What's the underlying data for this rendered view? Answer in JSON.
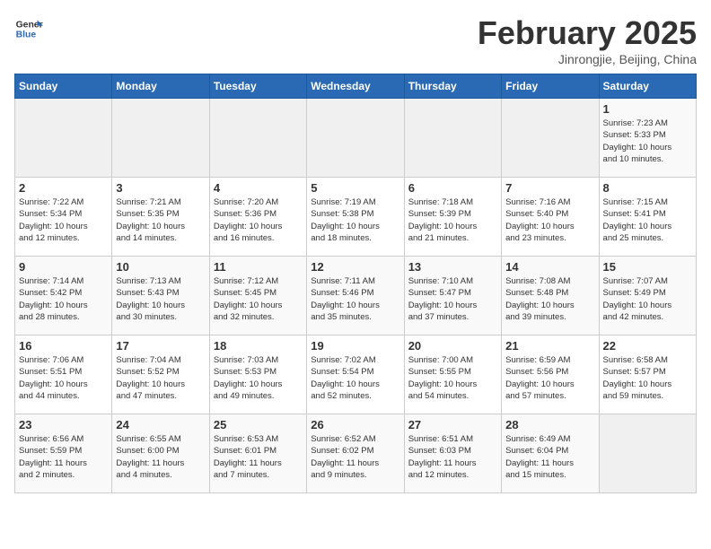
{
  "header": {
    "logo_general": "General",
    "logo_blue": "Blue",
    "month_title": "February 2025",
    "subtitle": "Jinrongjie, Beijing, China"
  },
  "days_of_week": [
    "Sunday",
    "Monday",
    "Tuesday",
    "Wednesday",
    "Thursday",
    "Friday",
    "Saturday"
  ],
  "weeks": [
    [
      {
        "day": "",
        "info": ""
      },
      {
        "day": "",
        "info": ""
      },
      {
        "day": "",
        "info": ""
      },
      {
        "day": "",
        "info": ""
      },
      {
        "day": "",
        "info": ""
      },
      {
        "day": "",
        "info": ""
      },
      {
        "day": "1",
        "info": "Sunrise: 7:23 AM\nSunset: 5:33 PM\nDaylight: 10 hours\nand 10 minutes."
      }
    ],
    [
      {
        "day": "2",
        "info": "Sunrise: 7:22 AM\nSunset: 5:34 PM\nDaylight: 10 hours\nand 12 minutes."
      },
      {
        "day": "3",
        "info": "Sunrise: 7:21 AM\nSunset: 5:35 PM\nDaylight: 10 hours\nand 14 minutes."
      },
      {
        "day": "4",
        "info": "Sunrise: 7:20 AM\nSunset: 5:36 PM\nDaylight: 10 hours\nand 16 minutes."
      },
      {
        "day": "5",
        "info": "Sunrise: 7:19 AM\nSunset: 5:38 PM\nDaylight: 10 hours\nand 18 minutes."
      },
      {
        "day": "6",
        "info": "Sunrise: 7:18 AM\nSunset: 5:39 PM\nDaylight: 10 hours\nand 21 minutes."
      },
      {
        "day": "7",
        "info": "Sunrise: 7:16 AM\nSunset: 5:40 PM\nDaylight: 10 hours\nand 23 minutes."
      },
      {
        "day": "8",
        "info": "Sunrise: 7:15 AM\nSunset: 5:41 PM\nDaylight: 10 hours\nand 25 minutes."
      }
    ],
    [
      {
        "day": "9",
        "info": "Sunrise: 7:14 AM\nSunset: 5:42 PM\nDaylight: 10 hours\nand 28 minutes."
      },
      {
        "day": "10",
        "info": "Sunrise: 7:13 AM\nSunset: 5:43 PM\nDaylight: 10 hours\nand 30 minutes."
      },
      {
        "day": "11",
        "info": "Sunrise: 7:12 AM\nSunset: 5:45 PM\nDaylight: 10 hours\nand 32 minutes."
      },
      {
        "day": "12",
        "info": "Sunrise: 7:11 AM\nSunset: 5:46 PM\nDaylight: 10 hours\nand 35 minutes."
      },
      {
        "day": "13",
        "info": "Sunrise: 7:10 AM\nSunset: 5:47 PM\nDaylight: 10 hours\nand 37 minutes."
      },
      {
        "day": "14",
        "info": "Sunrise: 7:08 AM\nSunset: 5:48 PM\nDaylight: 10 hours\nand 39 minutes."
      },
      {
        "day": "15",
        "info": "Sunrise: 7:07 AM\nSunset: 5:49 PM\nDaylight: 10 hours\nand 42 minutes."
      }
    ],
    [
      {
        "day": "16",
        "info": "Sunrise: 7:06 AM\nSunset: 5:51 PM\nDaylight: 10 hours\nand 44 minutes."
      },
      {
        "day": "17",
        "info": "Sunrise: 7:04 AM\nSunset: 5:52 PM\nDaylight: 10 hours\nand 47 minutes."
      },
      {
        "day": "18",
        "info": "Sunrise: 7:03 AM\nSunset: 5:53 PM\nDaylight: 10 hours\nand 49 minutes."
      },
      {
        "day": "19",
        "info": "Sunrise: 7:02 AM\nSunset: 5:54 PM\nDaylight: 10 hours\nand 52 minutes."
      },
      {
        "day": "20",
        "info": "Sunrise: 7:00 AM\nSunset: 5:55 PM\nDaylight: 10 hours\nand 54 minutes."
      },
      {
        "day": "21",
        "info": "Sunrise: 6:59 AM\nSunset: 5:56 PM\nDaylight: 10 hours\nand 57 minutes."
      },
      {
        "day": "22",
        "info": "Sunrise: 6:58 AM\nSunset: 5:57 PM\nDaylight: 10 hours\nand 59 minutes."
      }
    ],
    [
      {
        "day": "23",
        "info": "Sunrise: 6:56 AM\nSunset: 5:59 PM\nDaylight: 11 hours\nand 2 minutes."
      },
      {
        "day": "24",
        "info": "Sunrise: 6:55 AM\nSunset: 6:00 PM\nDaylight: 11 hours\nand 4 minutes."
      },
      {
        "day": "25",
        "info": "Sunrise: 6:53 AM\nSunset: 6:01 PM\nDaylight: 11 hours\nand 7 minutes."
      },
      {
        "day": "26",
        "info": "Sunrise: 6:52 AM\nSunset: 6:02 PM\nDaylight: 11 hours\nand 9 minutes."
      },
      {
        "day": "27",
        "info": "Sunrise: 6:51 AM\nSunset: 6:03 PM\nDaylight: 11 hours\nand 12 minutes."
      },
      {
        "day": "28",
        "info": "Sunrise: 6:49 AM\nSunset: 6:04 PM\nDaylight: 11 hours\nand 15 minutes."
      },
      {
        "day": "",
        "info": ""
      }
    ]
  ]
}
